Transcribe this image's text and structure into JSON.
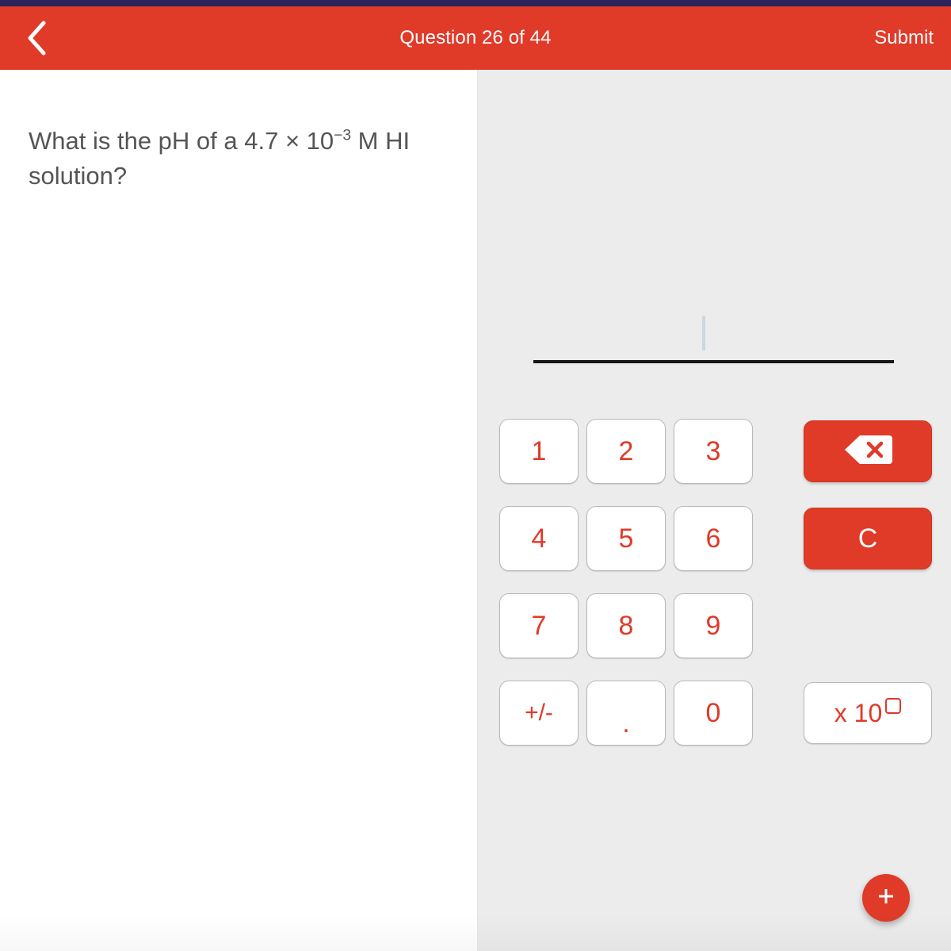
{
  "window": {
    "status_strip_color": "#2b2359",
    "accent_color": "#e03a28",
    "panel_background": "#ececec"
  },
  "header": {
    "back_label": "‹",
    "title": "Question 26 of 44",
    "question_number": 26,
    "question_total": 44,
    "submit_label": "Submit"
  },
  "question": {
    "prefix": "What is the pH of a 4.7 × 10",
    "exponent": "−3",
    "suffix": " M HI solution?"
  },
  "answer": {
    "value": "",
    "placeholder": ""
  },
  "keypad": {
    "digits": [
      {
        "label": "1",
        "name": "key-1"
      },
      {
        "label": "2",
        "name": "key-2"
      },
      {
        "label": "3",
        "name": "key-3"
      },
      {
        "label": "4",
        "name": "key-4"
      },
      {
        "label": "5",
        "name": "key-5"
      },
      {
        "label": "6",
        "name": "key-6"
      },
      {
        "label": "7",
        "name": "key-7"
      },
      {
        "label": "8",
        "name": "key-8"
      },
      {
        "label": "9",
        "name": "key-9"
      },
      {
        "label": "+/-",
        "name": "key-sign"
      },
      {
        "label": ".",
        "name": "key-decimal"
      },
      {
        "label": "0",
        "name": "key-0"
      }
    ],
    "actions": {
      "backspace_icon": "backspace-icon",
      "clear_label": "C",
      "exponent_label": "x 10"
    }
  },
  "fab": {
    "icon": "plus-icon",
    "label": "+"
  }
}
